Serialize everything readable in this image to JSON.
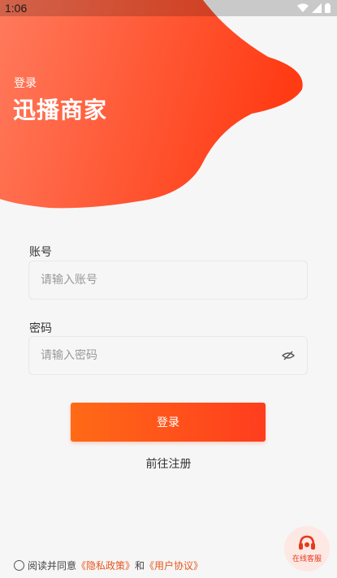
{
  "status_bar": {
    "time": "1:06"
  },
  "header": {
    "subtitle": "登录",
    "title": "迅播商家"
  },
  "account": {
    "label": "账号",
    "placeholder": "请输入账号"
  },
  "password": {
    "label": "密码",
    "placeholder": "请输入密码"
  },
  "login_button": "登录",
  "register_link": "前往注册",
  "customer_service": {
    "label": "在线客服"
  },
  "agreement": {
    "prefix": "阅读并同意",
    "privacy": "《隐私政策》",
    "and": "和",
    "terms": "《用户协议》"
  },
  "colors": {
    "accent": "#ff4a1c",
    "accent_light": "#ff6f4a",
    "link": "#e8561f"
  }
}
